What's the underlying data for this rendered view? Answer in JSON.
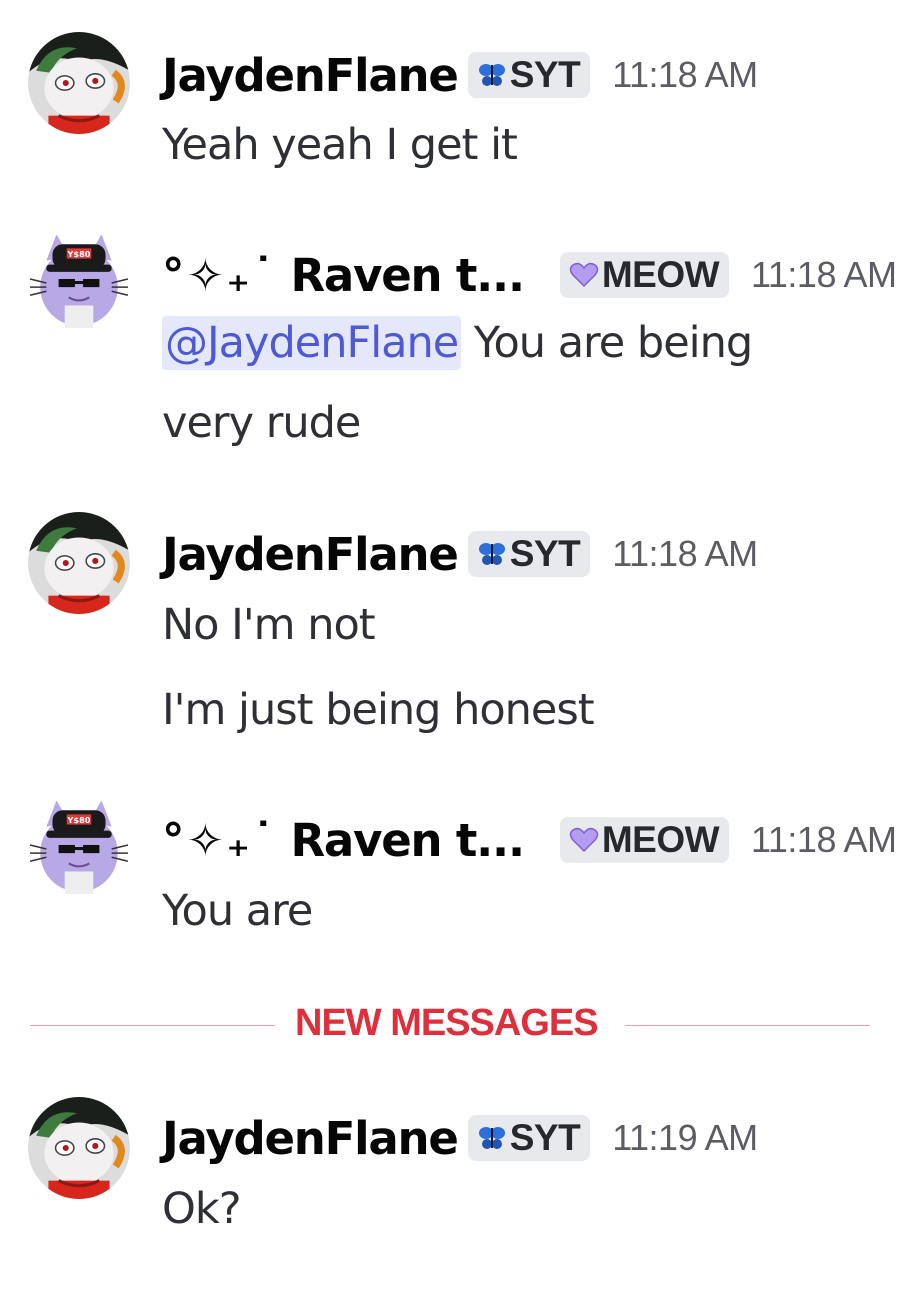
{
  "messages": [
    {
      "author": "JaydenFlane",
      "tag": "SYT",
      "time": "11:18 AM",
      "lines": [
        "Yeah yeah I get it"
      ]
    },
    {
      "author_decoration": "°✧₊˙",
      "author": "Raven t...",
      "tag": "MEOW",
      "time": "11:18 AM",
      "mention": "@JaydenFlane",
      "lines": [
        "You are being",
        "very rude"
      ]
    },
    {
      "author": "JaydenFlane",
      "tag": "SYT",
      "time": "11:18 AM",
      "lines": [
        "No I'm not",
        "I'm just being honest"
      ]
    },
    {
      "author_decoration": "°✧₊˙",
      "author": "Raven t...",
      "tag": "MEOW",
      "time": "11:18 AM",
      "lines": [
        "You are"
      ]
    },
    {
      "author": "JaydenFlane",
      "tag": "SYT",
      "time": "11:19 AM",
      "lines": [
        "Ok?"
      ]
    }
  ],
  "divider": {
    "label": "NEW MESSAGES"
  },
  "avatar_text": {
    "cap": "Y$80"
  },
  "icons": {
    "syt_tag": "butterfly-icon",
    "meow_tag": "purple-heart-icon"
  },
  "colors": {
    "mention_bg": "#e5e8fb",
    "mention_text": "#4e5ad4",
    "new_messages": "#de2f3c",
    "tag_bg": "#e8e9ec"
  }
}
